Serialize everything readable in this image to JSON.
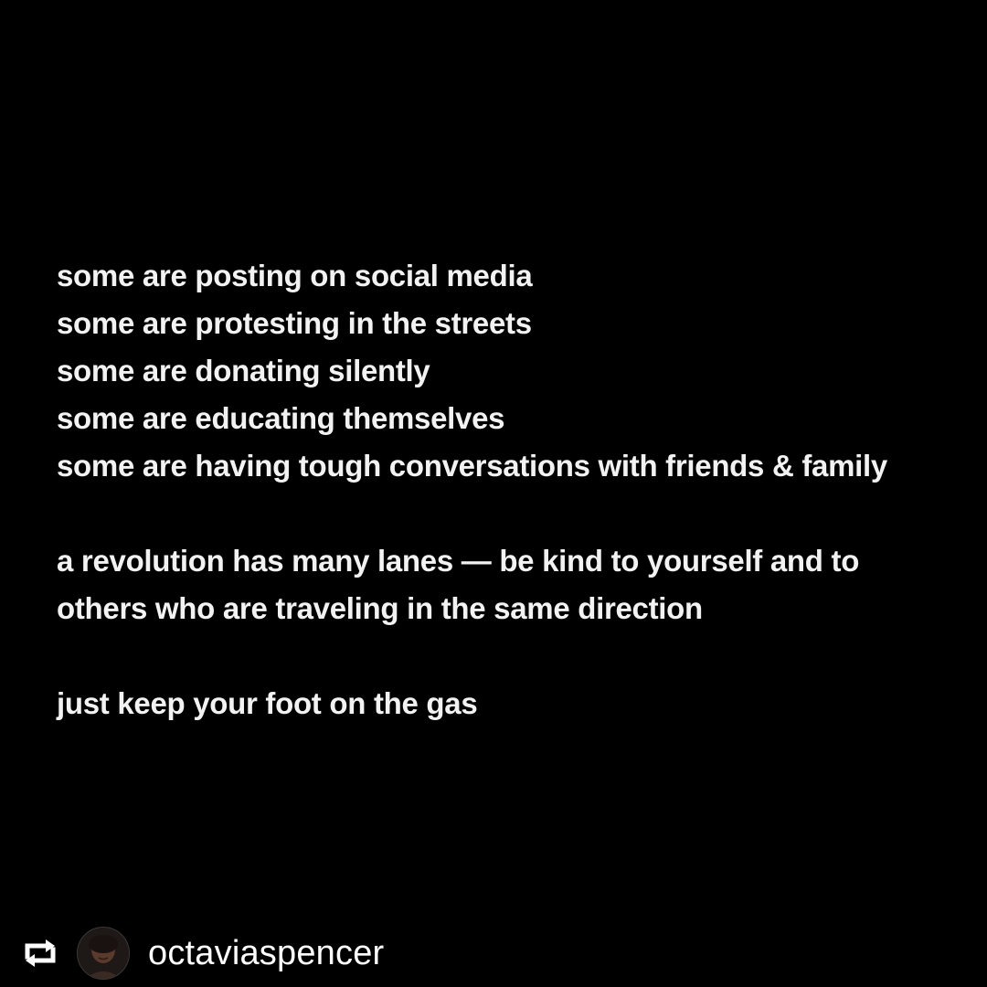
{
  "poem": {
    "stanza1": [
      "some are posting on social media",
      "some are protesting in the streets",
      "some are donating silently",
      "some are educating themselves",
      "some are having tough conversations with friends & family"
    ],
    "stanza2": [
      "a revolution has many lanes — be kind to yourself and to",
      "others who are traveling in the same direction"
    ],
    "stanza3": [
      "just keep your foot on the gas"
    ]
  },
  "repost": {
    "icon": "repost-icon",
    "avatar": "user-avatar",
    "username": "octaviaspencer"
  },
  "colors": {
    "background": "#000000",
    "text": "#f2f2f2"
  }
}
